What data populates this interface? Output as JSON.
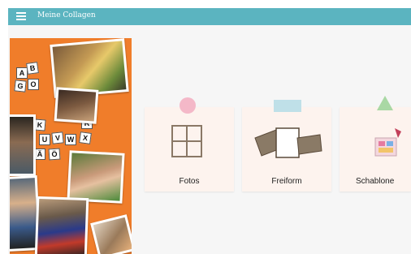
{
  "app": {
    "title": "Meine Collagen"
  },
  "collage": {
    "letters": [
      "A",
      "B",
      "G",
      "O",
      "K",
      "R",
      "U",
      "V",
      "W",
      "X",
      "Ä",
      "Ö"
    ]
  },
  "cards": [
    {
      "label": "Fotos"
    },
    {
      "label": "Freiform"
    },
    {
      "label": "Schablone"
    }
  ],
  "colors": {
    "topbar": "#5bb4c0",
    "collage_bg": "#f07d2a",
    "card_bg": "#fdf3ee",
    "pin_pink": "#f4b8c8",
    "tape_blue": "#bfe0e8",
    "triangle_green": "#a9d8a4"
  }
}
